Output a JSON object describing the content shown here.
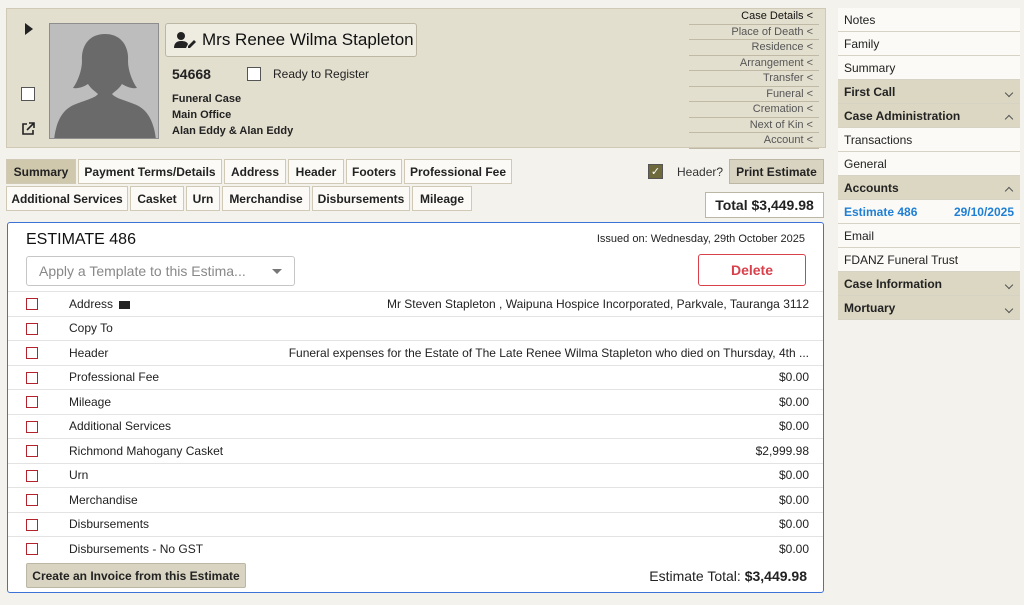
{
  "header": {
    "client_name": "Mrs Renee Wilma Stapleton",
    "case_number": "54668",
    "ready_label": "Ready to Register",
    "case_type": "Funeral Case",
    "office": "Main Office",
    "staff_line": "Alan Eddy  &  Alan Eddy",
    "detail_links": [
      "Case Details <",
      "Place of Death <",
      "Residence <",
      "Arrangement <",
      "Transfer <",
      "Funeral <",
      "Cremation <",
      "Next of Kin <",
      "Account <"
    ]
  },
  "tabs": {
    "row1": [
      "Summary",
      "Payment Terms/Details",
      "Address",
      "Header",
      "Footers",
      "Professional Fee"
    ],
    "row2": [
      "Additional Services",
      "Casket",
      "Urn",
      "Merchandise",
      "Disbursements",
      "Mileage"
    ]
  },
  "toolbar": {
    "header_label": "Header?",
    "print_label": "Print Estimate",
    "total_label": "Total $3,449.98"
  },
  "estimate": {
    "title": "ESTIMATE 486",
    "issued": "Issued on: Wednesday, 29th October 2025",
    "template_placeholder": "Apply a Template to this Estima...",
    "delete_label": "Delete",
    "rows": [
      {
        "label": "Address",
        "value": "Mr Steven Stapleton , Waipuna Hospice Incorporated, Parkvale, Tauranga 3112"
      },
      {
        "label": "Copy To",
        "value": ""
      },
      {
        "label": "Header",
        "value": "Funeral expenses for the Estate of The Late Renee Wilma Stapleton who died on Thursday, 4th ..."
      },
      {
        "label": "Professional Fee",
        "value": "$0.00"
      },
      {
        "label": "Mileage",
        "value": "$0.00"
      },
      {
        "label": "Additional Services",
        "value": "$0.00"
      },
      {
        "label": "Richmond Mahogany Casket",
        "value": "$2,999.98"
      },
      {
        "label": "Urn",
        "value": "$0.00"
      },
      {
        "label": "Merchandise",
        "value": "$0.00"
      },
      {
        "label": "Disbursements",
        "value": "$0.00"
      },
      {
        "label": "Disbursements - No GST",
        "value": "$0.00"
      }
    ],
    "create_invoice_label": "Create an Invoice from this Estimate",
    "total_prefix": "Estimate Total: ",
    "total_value": "$3,449.98"
  },
  "sidebar": {
    "items": [
      {
        "label": "Notes"
      },
      {
        "label": "Family"
      },
      {
        "label": "Summary"
      },
      {
        "label": "First Call"
      },
      {
        "label": "Case Administration"
      },
      {
        "label": "Transactions"
      },
      {
        "label": "General"
      },
      {
        "label": "Accounts"
      },
      {
        "label": "Estimate 486",
        "date": "29/10/2025"
      },
      {
        "label": "Email"
      },
      {
        "label": "FDANZ Funeral Trust"
      },
      {
        "label": "Case Information"
      },
      {
        "label": "Mortuary"
      }
    ]
  },
  "colors": {
    "accent_blue": "#1f7fd4",
    "delete_red": "#d8414b",
    "panel_border": "#3d72d6"
  }
}
